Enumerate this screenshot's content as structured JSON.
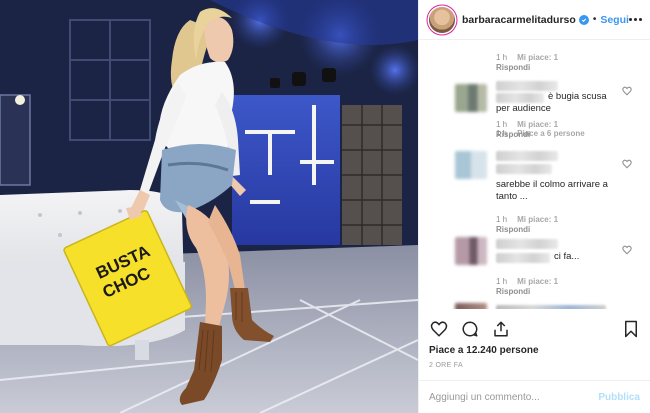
{
  "post": {
    "photo_sign_text_line1": "BUSTA",
    "photo_sign_text_line2": "CHOC"
  },
  "header": {
    "username": "barbaracarmelitadurso",
    "separator": "•",
    "follow_label": "Segui",
    "more_icon": "more-horizontal-icon",
    "verified_icon": "verified-badge-icon",
    "verified_color": "#3897f0"
  },
  "comments": [
    {
      "age": "1 h",
      "likes": "Mi piace: 1",
      "reply": "Rispondi"
    },
    {
      "age": "1 h",
      "likes": "Mi piace: 1",
      "reply": "Rispondi",
      "text": "è bugia scusa\nper audience"
    },
    {
      "age": "1 h",
      "likes": "Piace a 6 persone",
      "reply": "Rispondi",
      "text": "sarebbe il colmo arrivare a\ntanto ..."
    },
    {
      "age": "1 h",
      "likes": "Mi piace: 1",
      "reply": "Rispondi",
      "text": "ci fa..."
    },
    {
      "age": "1 h",
      "likes": "Mi piace: 1",
      "reply": "Rispondi"
    }
  ],
  "actions": {
    "like_icon": "heart-icon",
    "comment_icon": "comment-icon",
    "share_icon": "share-icon",
    "save_icon": "bookmark-icon"
  },
  "like_count": "Piace a 12.240 persone",
  "time_ago": "2 ORE FA",
  "add_comment": {
    "placeholder": "Aggiungi un commento...",
    "publish_label": "Pubblica"
  },
  "colors": {
    "link_blue": "#3897f0",
    "publish_disabled": "#b2dffc",
    "muted_text": "#8e8e8e"
  }
}
